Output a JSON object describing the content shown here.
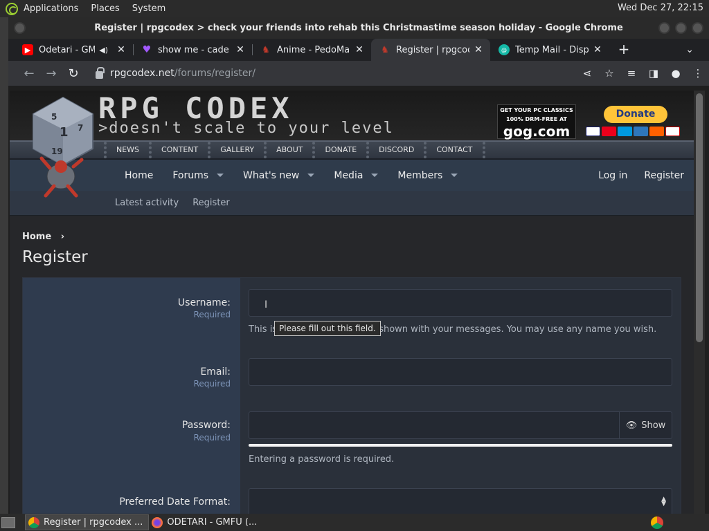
{
  "panel": {
    "menus": [
      "Applications",
      "Places",
      "System"
    ],
    "clock": "Wed Dec 27, 22:15"
  },
  "window": {
    "title": "Register | rpgcodex > check your friends into rehab this Christmastime season holiday - Google Chrome"
  },
  "tabs": [
    {
      "label": "Odetari - GMF",
      "favicon_color": "#ff0000",
      "muted": true
    },
    {
      "label": "show me - cade cl",
      "favicon_color": "#a259ff",
      "muted": false
    },
    {
      "label": "Anime - PedoMar",
      "favicon_color": "#c0392b",
      "muted": false
    },
    {
      "label": "Register | rpgcode",
      "favicon_color": "#c0392b",
      "muted": false,
      "active": true
    },
    {
      "label": "Temp Mail - Dispo",
      "favicon_color": "#14b8a6",
      "muted": false
    }
  ],
  "omnibox": {
    "host": "rpgcodex.net",
    "path": "/forums/register/"
  },
  "site": {
    "logo": "RPG CODEX",
    "slogan": ">doesn't scale to your level",
    "gog_line1": "GET YOUR PC CLASSICS",
    "gog_line2": "100% DRM-FREE AT",
    "gog_brand": "gog.com",
    "donate": "Donate",
    "submenu": [
      "NEWS",
      "CONTENT",
      "GALLERY",
      "ABOUT",
      "DONATE",
      "DISCORD",
      "CONTACT"
    ],
    "mainnav": [
      {
        "label": "Home",
        "dropdown": false
      },
      {
        "label": "Forums",
        "dropdown": true
      },
      {
        "label": "What's new",
        "dropdown": true
      },
      {
        "label": "Media",
        "dropdown": true
      },
      {
        "label": "Members",
        "dropdown": true
      }
    ],
    "login": "Log in",
    "register": "Register",
    "subnav": [
      "Latest activity",
      "Register"
    ]
  },
  "page": {
    "breadcrumb": "Home",
    "title": "Register"
  },
  "form": {
    "username_label": "Username:",
    "username_required": "Required",
    "username_hint": "This is the name that will be shown with your messages. You may use any name you wish.",
    "tooltip": "Please fill out this field.",
    "email_label": "Email:",
    "email_required": "Required",
    "password_label": "Password:",
    "password_required": "Required",
    "show_label": "Show",
    "password_hint": "Entering a password is required.",
    "date_format_label": "Preferred Date Format:"
  },
  "taskbar": {
    "tasks": [
      "Register | rpgcodex ...",
      "ODETARI - GMFU (..."
    ]
  }
}
